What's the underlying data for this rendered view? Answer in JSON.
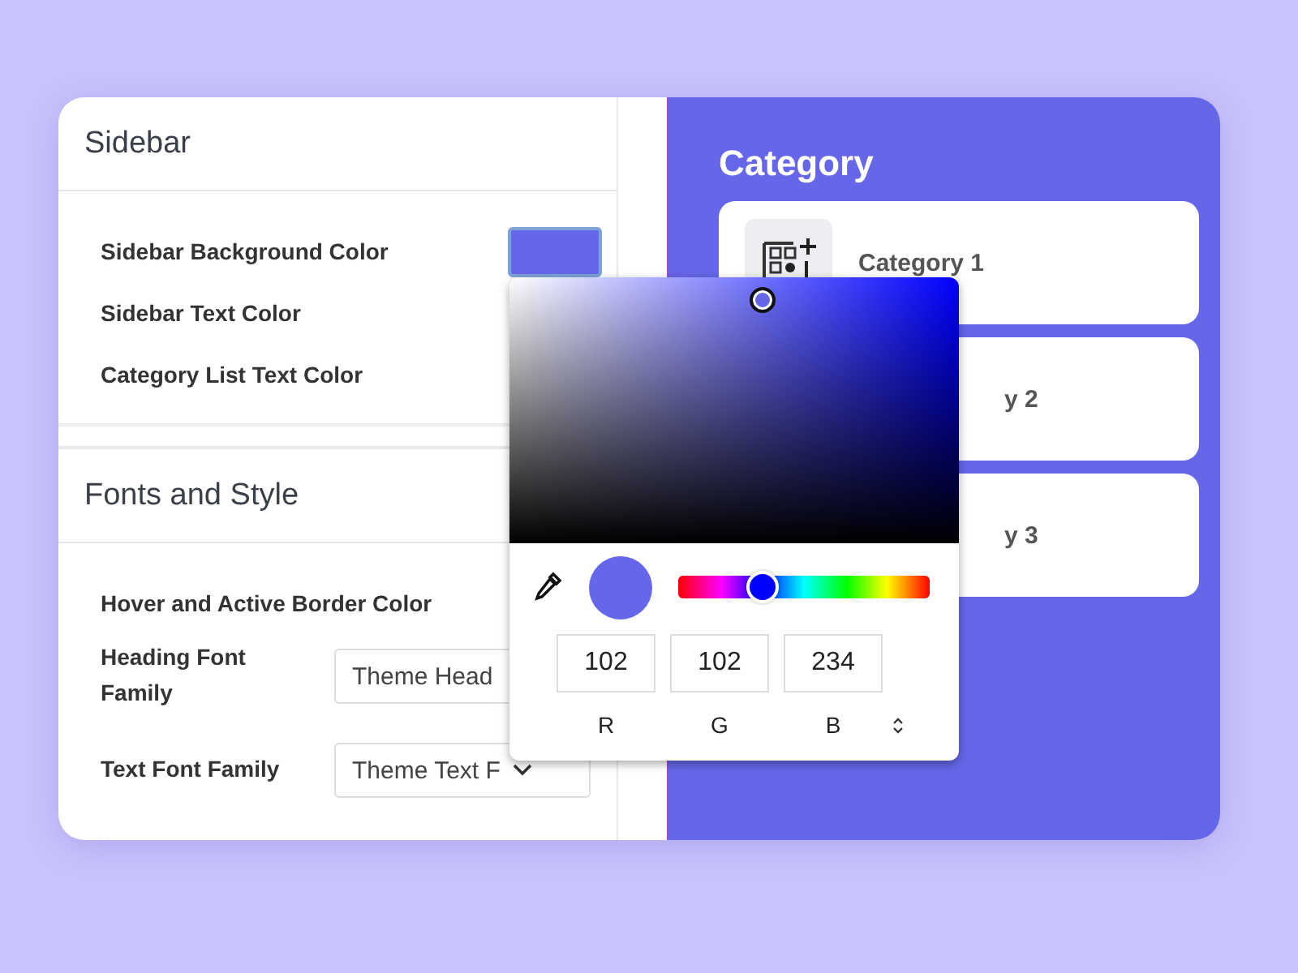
{
  "sections": [
    {
      "title": "Sidebar",
      "rows": [
        {
          "kind": "swatch",
          "label": "Sidebar Background Color"
        },
        {
          "kind": "plain",
          "label": "Sidebar Text Color"
        },
        {
          "kind": "plain",
          "label": "Category List Text Color"
        }
      ]
    },
    {
      "title": "Fonts and Style",
      "rows": [
        {
          "kind": "plain",
          "label": "Hover and Active Border Color"
        },
        {
          "kind": "select",
          "label": "Heading Font Family",
          "value": "Theme Head",
          "chevron": false
        },
        {
          "kind": "select",
          "label": "Text Font Family",
          "value": "Theme Text F",
          "chevron": true
        }
      ]
    }
  ],
  "preview": {
    "title": "Category",
    "items": [
      {
        "kind": "full",
        "label": "Category 1"
      },
      {
        "kind": "cut",
        "label": "y 2"
      },
      {
        "kind": "cut",
        "label": "y 3"
      }
    ]
  },
  "picker": {
    "hue_slider": {
      "level": 0.333
    },
    "r": "102",
    "g": "102",
    "b": "234",
    "labels": [
      "R",
      "G",
      "B"
    ]
  }
}
